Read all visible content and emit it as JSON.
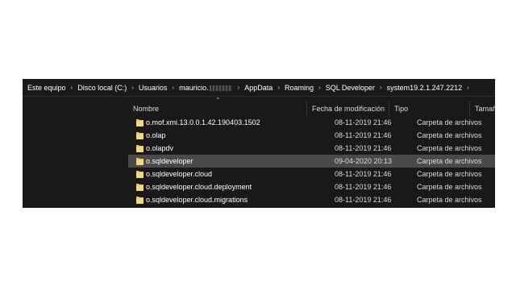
{
  "breadcrumb": {
    "items": [
      "Este equipo",
      "Disco local (C:)",
      "Usuarios",
      "mauricio.",
      "AppData",
      "Roaming",
      "SQL Developer",
      "system19.2.1.247.2212"
    ],
    "separator": "›"
  },
  "columns": {
    "name": "Nombre",
    "date": "Fecha de modificación",
    "type": "Tipo",
    "size": "Tamaño"
  },
  "sort_indicator": "⌃",
  "files": [
    {
      "name": "o.mof.xmi.13.0.0.1.42.190403.1502",
      "date": "08-11-2019 21:46",
      "type": "Carpeta de archivos"
    },
    {
      "name": "o.olap",
      "date": "08-11-2019 21:46",
      "type": "Carpeta de archivos"
    },
    {
      "name": "o.olapdv",
      "date": "08-11-2019 21:46",
      "type": "Carpeta de archivos"
    },
    {
      "name": "o.sqldeveloper",
      "date": "09-04-2020 20:13",
      "type": "Carpeta de archivos",
      "selected": true
    },
    {
      "name": "o.sqldeveloper.cloud",
      "date": "08-11-2019 21:46",
      "type": "Carpeta de archivos"
    },
    {
      "name": "o.sqldeveloper.cloud.deployment",
      "date": "08-11-2019 21:46",
      "type": "Carpeta de archivos"
    },
    {
      "name": "o.sqldeveloper.cloud.migrations",
      "date": "08-11-2019 21:46",
      "type": "Carpeta de archivos"
    }
  ],
  "icons": {
    "folder": "folder-icon",
    "folder_color": "#e8c35a"
  },
  "colors": {
    "background": "#191919",
    "selected_row": "#4a4a4a",
    "text": "#ffffff"
  }
}
